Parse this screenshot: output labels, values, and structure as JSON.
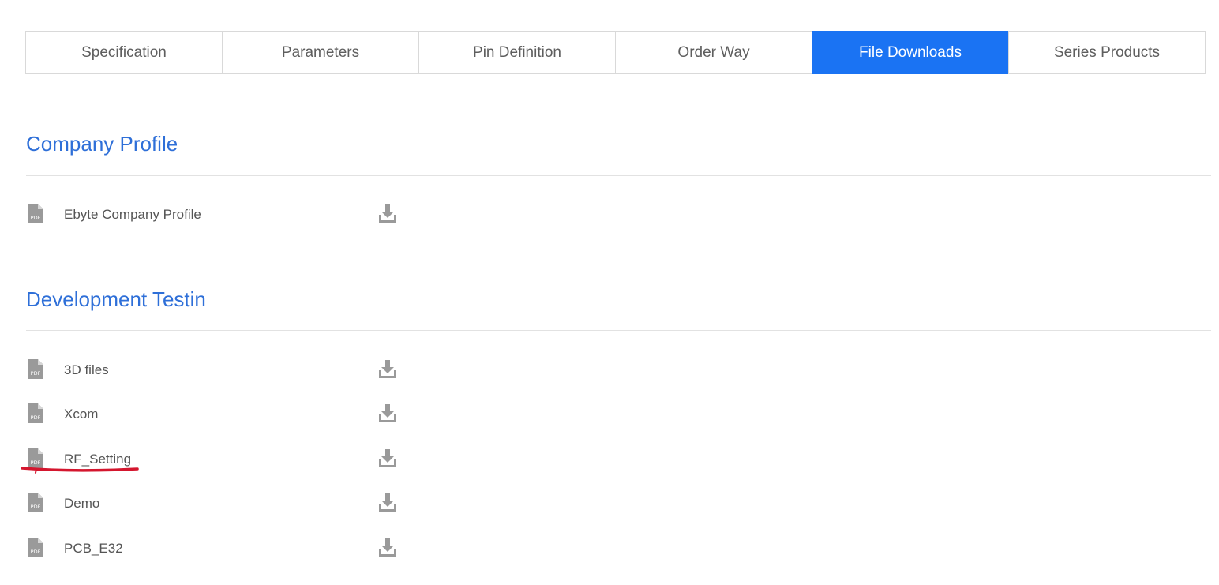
{
  "tabs": [
    {
      "label": "Specification",
      "active": false
    },
    {
      "label": "Parameters",
      "active": false
    },
    {
      "label": "Pin Definition",
      "active": false
    },
    {
      "label": "Order Way",
      "active": false
    },
    {
      "label": "File Downloads",
      "active": true
    },
    {
      "label": "Series Products",
      "active": false
    }
  ],
  "sections": [
    {
      "title": "Company Profile",
      "files": [
        {
          "name": "Ebyte Company Profile",
          "icon": "pdf-icon",
          "action_icon": "download-icon"
        }
      ]
    },
    {
      "title": "Development Testin",
      "files": [
        {
          "name": "3D files",
          "icon": "pdf-icon",
          "action_icon": "download-icon"
        },
        {
          "name": "Xcom",
          "icon": "pdf-icon",
          "action_icon": "download-icon"
        },
        {
          "name": "RF_Setting",
          "icon": "pdf-icon",
          "action_icon": "download-icon"
        },
        {
          "name": "Demo",
          "icon": "pdf-icon",
          "action_icon": "download-icon"
        },
        {
          "name": "PCB_E32",
          "icon": "pdf-icon",
          "action_icon": "download-icon"
        }
      ]
    }
  ],
  "colors": {
    "accent": "#1a73f3",
    "heading": "#2e6fd8",
    "annotation": "#d4162e"
  }
}
